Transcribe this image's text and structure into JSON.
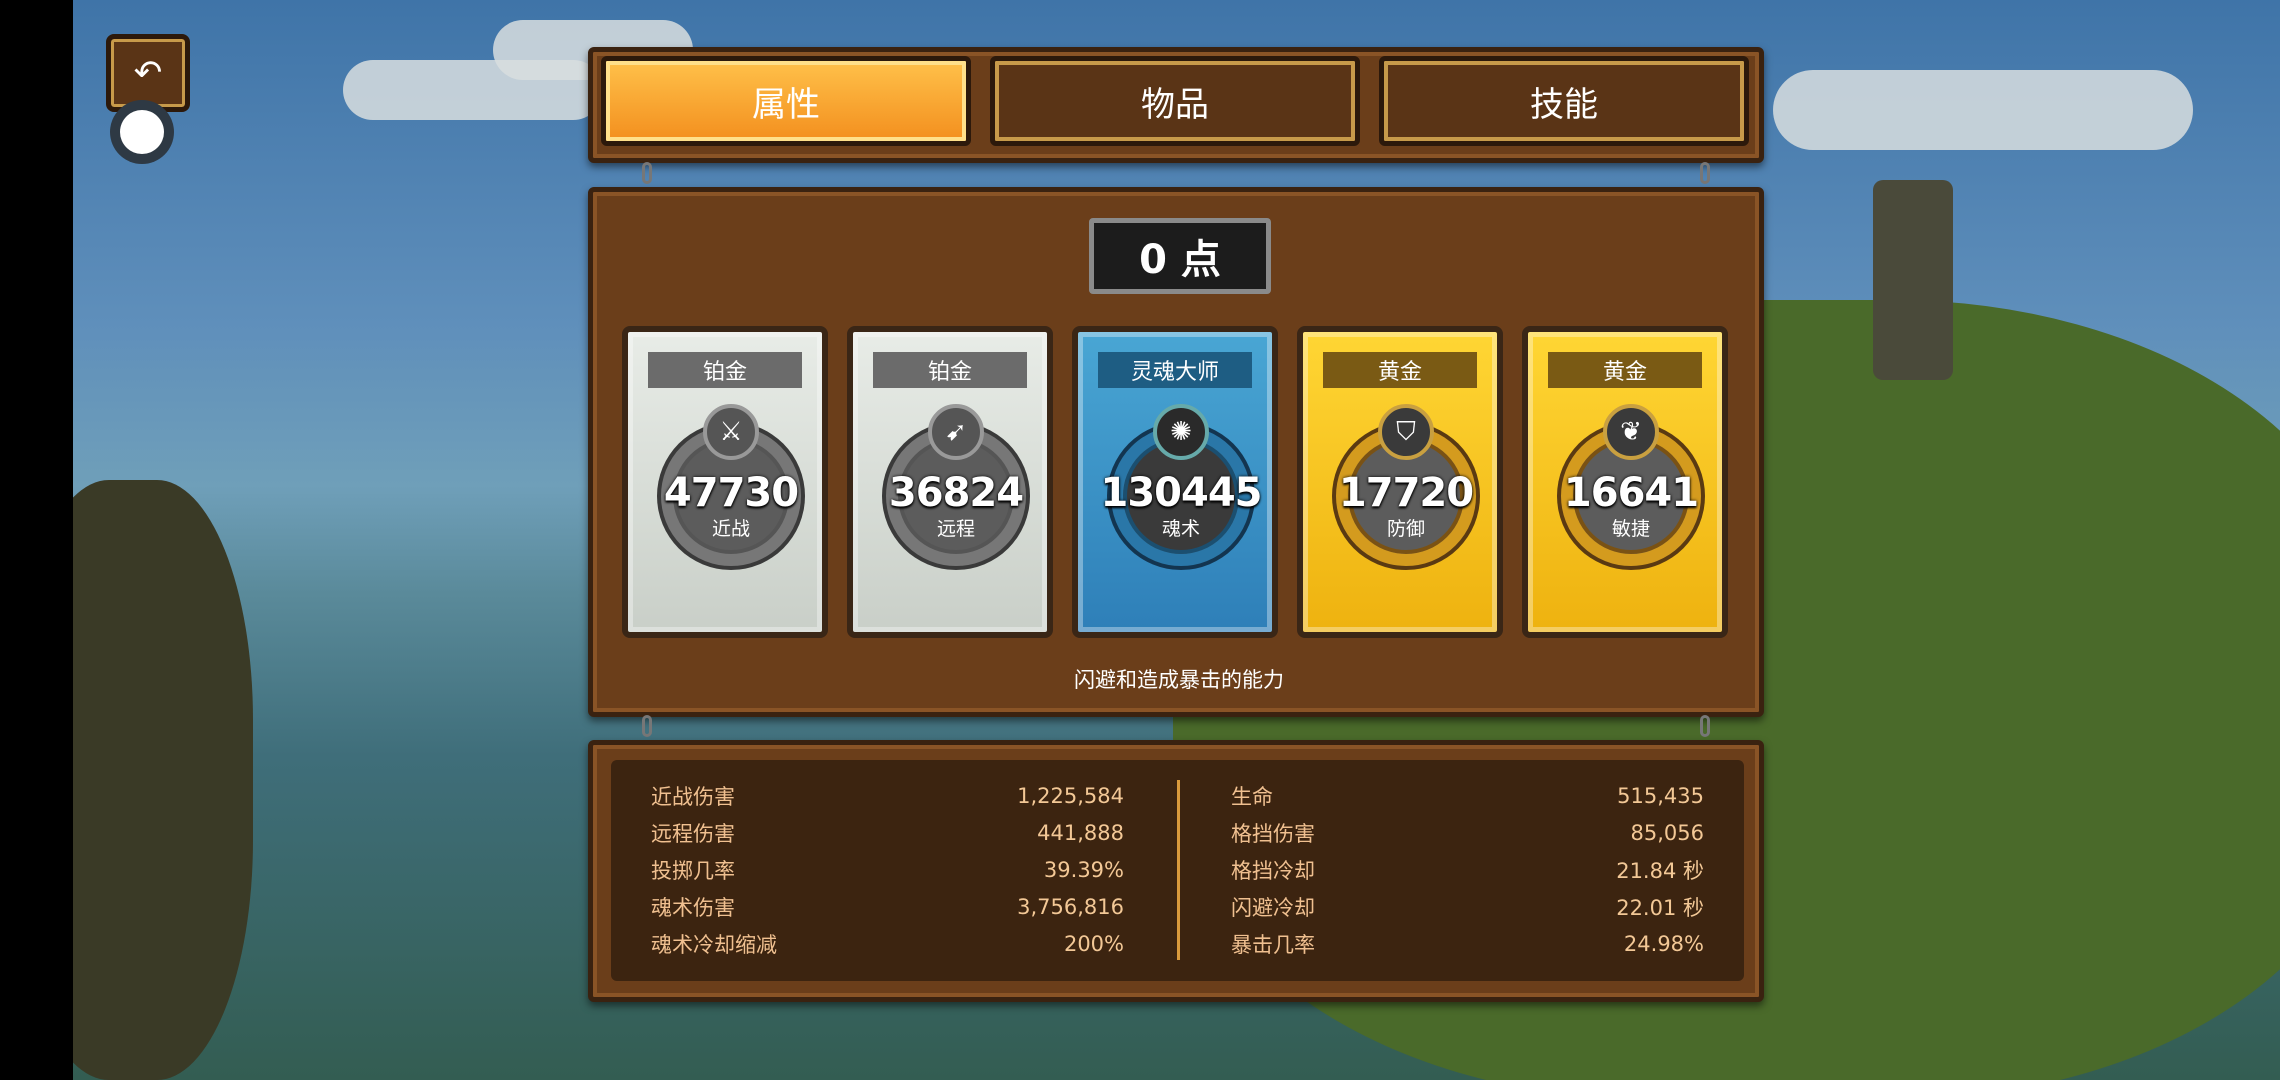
{
  "tabs": [
    {
      "label": "属性",
      "active": true
    },
    {
      "label": "物品",
      "active": false
    },
    {
      "label": "技能",
      "active": false
    }
  ],
  "points": "0 点",
  "cards": [
    {
      "tier": "铂金",
      "value": "47730",
      "label": "近战",
      "icon": "sword-icon",
      "style": "platinum"
    },
    {
      "tier": "铂金",
      "value": "36824",
      "label": "远程",
      "icon": "bow-icon",
      "style": "platinum"
    },
    {
      "tier": "灵魂大师",
      "value": "130445",
      "label": "魂术",
      "icon": "soul-icon",
      "style": "soul"
    },
    {
      "tier": "黄金",
      "value": "17720",
      "label": "防御",
      "icon": "shield-icon",
      "style": "gold"
    },
    {
      "tier": "黄金",
      "value": "16641",
      "label": "敏捷",
      "icon": "wing-icon",
      "style": "gold"
    }
  ],
  "description": "闪避和造成暴击的能力",
  "stats_left": [
    {
      "name": "近战伤害",
      "value": "1,225,584"
    },
    {
      "name": "远程伤害",
      "value": "441,888"
    },
    {
      "name": "投掷几率",
      "value": "39.39%"
    },
    {
      "name": "魂术伤害",
      "value": "3,756,816"
    },
    {
      "name": "魂术冷却缩减",
      "value": "200%"
    }
  ],
  "stats_right": [
    {
      "name": "生命",
      "value": "515,435"
    },
    {
      "name": "格挡伤害",
      "value": "85,056"
    },
    {
      "name": "格挡冷却",
      "value": "21.84 秒"
    },
    {
      "name": "闪避冷却",
      "value": "22.01 秒"
    },
    {
      "name": "暴击几率",
      "value": "24.98%"
    }
  ],
  "colors": {
    "accent": "#f5a22a",
    "wood": "#6b3e1a",
    "stat_text": "#f0c090"
  }
}
